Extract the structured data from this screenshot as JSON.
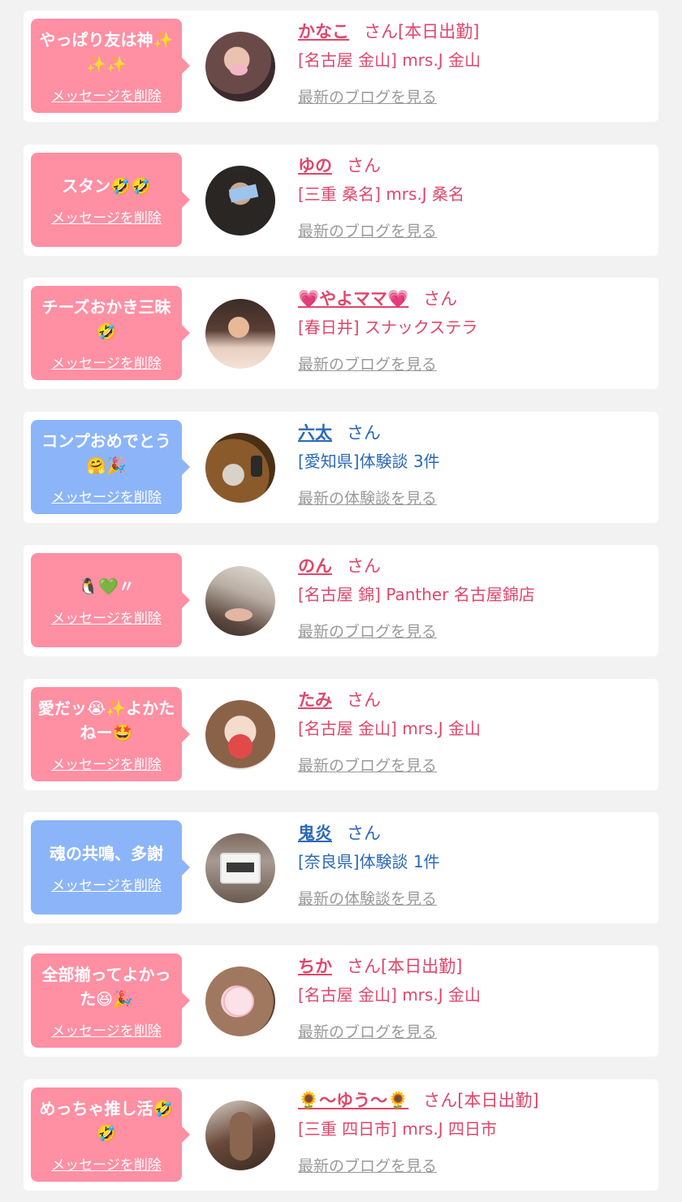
{
  "cards": [
    {
      "message": "やっぱり友は神✨✨✨",
      "delete_label": "メッセージを削除",
      "name": "かなこ",
      "suffix": "さん[本日出勤]",
      "detail": "[名古屋 金山] mrs.J 金山",
      "link": "最新のブログを見る",
      "theme": "pink"
    },
    {
      "message": "スタン🤣🤣",
      "delete_label": "メッセージを削除",
      "name": "ゆの",
      "suffix": "さん",
      "detail": "[三重 桑名] mrs.J 桑名",
      "link": "最新のブログを見る",
      "theme": "pink"
    },
    {
      "message": "チーズおかき三昧🤣",
      "delete_label": "メッセージを削除",
      "name": "💗やよママ💗",
      "suffix": "さん",
      "detail": "[春日井] スナックステラ",
      "link": "最新のブログを見る",
      "theme": "pink"
    },
    {
      "message": "コンプおめでとう🤗🎉",
      "delete_label": "メッセージを削除",
      "name": "六太",
      "suffix": "さん",
      "detail": "[愛知県]体験談 3件",
      "link": "最新の体験談を見る",
      "theme": "blue"
    },
    {
      "message": "🐧💚〃",
      "delete_label": "メッセージを削除",
      "name": "のん",
      "suffix": "さん",
      "detail": "[名古屋 錦] Panther 名古屋錦店",
      "link": "最新のブログを見る",
      "theme": "pink"
    },
    {
      "message": "愛だッ😭✨よかたねー🤩",
      "delete_label": "メッセージを削除",
      "name": "たみ",
      "suffix": "さん",
      "detail": "[名古屋 金山] mrs.J 金山",
      "link": "最新のブログを見る",
      "theme": "pink"
    },
    {
      "message": "魂の共鳴、多謝",
      "delete_label": "メッセージを削除",
      "name": "鬼炎",
      "suffix": "さん",
      "detail": "[奈良県]体験談 1件",
      "link": "最新の体験談を見る",
      "theme": "blue"
    },
    {
      "message": "全部揃ってよかった😆🎉",
      "delete_label": "メッセージを削除",
      "name": "ちか",
      "suffix": "さん[本日出勤]",
      "detail": "[名古屋 金山] mrs.J 金山",
      "link": "最新のブログを見る",
      "theme": "pink"
    },
    {
      "message": "めっちゃ推し活🤣🤣",
      "delete_label": "メッセージを削除",
      "name": "🌻～ゆう～🌻",
      "suffix": "さん[本日出勤]",
      "detail": "[三重 四日市] mrs.J 四日市",
      "link": "最新のブログを見る",
      "theme": "pink"
    }
  ],
  "colors": {
    "pink_bubble": "#ff8fa3",
    "blue_bubble": "#8cb5f9",
    "pink_text": "#e0466b",
    "blue_text": "#2b69b8",
    "link_gray": "#9a9a9a",
    "page_bg": "#f2f2f2"
  }
}
